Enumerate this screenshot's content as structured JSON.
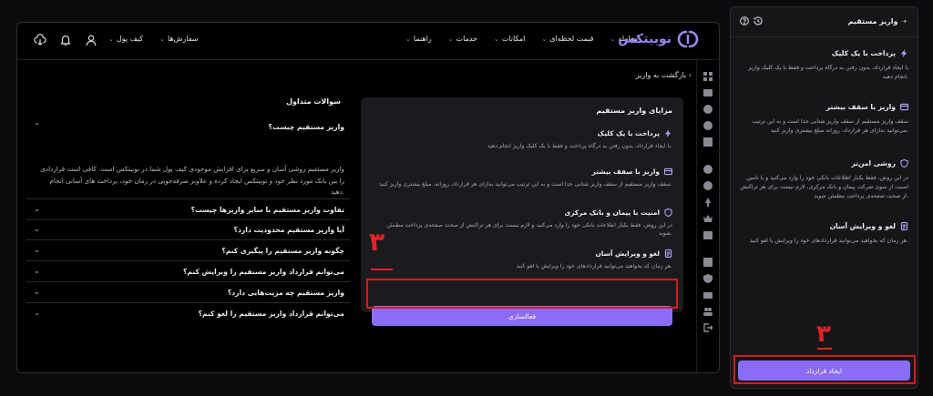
{
  "header": {
    "logo_text": "نوبیتکس",
    "nav": [
      "معامله",
      "قیمت لحظه‌ای",
      "امکانات",
      "خدمات",
      "راهنما"
    ],
    "user_menu": [
      "کیف پول",
      "سفارش‌ها"
    ]
  },
  "back_link": "بازگشت به واریز",
  "benefits": {
    "title": "مزایای واریز مستقیم",
    "items": [
      {
        "title": "پرداخت با یک کلیک",
        "desc": "با ایجاد قرارداد، بدون رفتن به درگاه پرداخت و فقط با یک کلیک واریز انجام دهید.",
        "icon": "lightning-icon"
      },
      {
        "title": "واریز با سقف بیشتر",
        "desc": "سقف واریز مستقیم از سقف واریز شتابی جدا است و به این ترتیب می‌توانید به‌ازای هر قرارداد، روزانه، مبلغ بیشتری واریز کنید.",
        "icon": "card-icon"
      },
      {
        "title": "امنیت با پیمان و بانک مرکزی",
        "desc": "در این روش، فقط یکبار اطلاعات بانکی خود را وارد می‌کنید و لازم نیست برای هر تراکنش از صحت صفحه‌ی پرداخت مطمئن شوید.",
        "icon": "shield-icon"
      },
      {
        "title": "لغو و ویرایش آسان",
        "desc": "هر زمان که بخواهید می‌توانید قراردادهای خود را ویرایش یا لغو کنید.",
        "icon": "document-icon"
      }
    ],
    "button_label": "فعالسازی",
    "annotation": "۳"
  },
  "faq": {
    "title": "سوالات متداول",
    "items": [
      {
        "q": "واریز مستقیم چیست؟",
        "expanded": true,
        "a": "واریز مستقیم روشی آسان و سریع برای افزایش موجودی کیف پول شما در نوبیتکس است. کافی است قراردادی را بین بانک مورد نظر خود و نوبیتکس ایجاد کرده و علاوبر صرفه‌جویی در زمان خود، پرداخت های آسانی انجام دهید."
      },
      {
        "q": "تفاوت واریز مستقیم با سایر واریزها چیست؟",
        "expanded": false
      },
      {
        "q": "آیا واریز مستقیم محدودیت دارد؟",
        "expanded": false
      },
      {
        "q": "چگونه واریز مستقیم را پیگیری کنم؟",
        "expanded": false
      },
      {
        "q": "می‌توانم قرارداد واریز مستقیم را ویرایش کنم؟",
        "expanded": false
      },
      {
        "q": "واریز مستقیم چه مزیت‌هایی دارد؟",
        "expanded": false
      },
      {
        "q": "می‌توانم قرارداد واریز مستقیم را لغو کنم؟",
        "expanded": false
      }
    ]
  },
  "panel": {
    "title": "واریز مستقیم",
    "items": [
      {
        "title": "پرداخت با یک کلیک",
        "desc": "با ایجاد قرارداد، بدون رفتن به درگاه پرداخت و فقط با یک کلیک واریز انجام دهید.",
        "icon": "lightning-icon"
      },
      {
        "title": "واریز با سقف بیشتر",
        "desc": "سقف واریز مستقیم از سقف واریز شتابی جدا است و به این ترتیب می‌توانید به‌ازای هر قرارداد، روزانه مبلغ بیشتری واریز کنید.",
        "icon": "card-icon"
      },
      {
        "title": "روشی امن‌تر",
        "desc": "در این روش، فقط یکبار اطلاعات بانکی خود را وارد می‌کنید و با تامین امنیت از سوی شرکت پیمان و بانک مرکزی، لازم نیست برای هر تراکنش از صحت صفحه‌ی پرداخت مطمئن شوید.",
        "icon": "shield-icon"
      },
      {
        "title": "لغو و ویرایش آسان",
        "desc": "هر زمان که بخواهید می‌توانید قراردادهای خود را ویرایش یا لغو کنید.",
        "icon": "document-icon"
      }
    ],
    "button_label": "ایجاد قرارداد",
    "annotation": "۳"
  },
  "colors": {
    "accent": "#8b6cf5",
    "annotation": "#e02424",
    "background": "#000000"
  }
}
